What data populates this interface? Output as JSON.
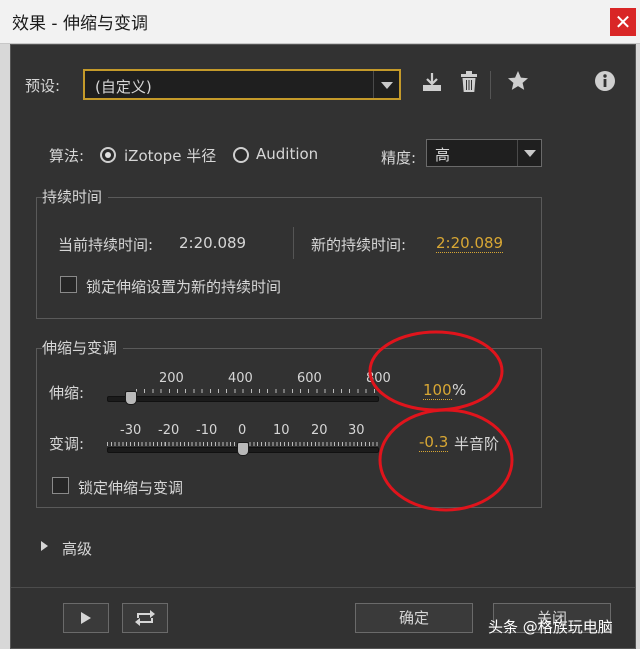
{
  "window": {
    "title": "效果 - 伸缩与变调",
    "close_glyph": "✕"
  },
  "preset": {
    "label": "预设:",
    "value": "(自定义)"
  },
  "toolbar": {
    "save_icon": "download-icon",
    "delete_icon": "trash-icon",
    "favorite_icon": "star-icon",
    "info_icon": "info-icon"
  },
  "algorithm": {
    "label": "算法:",
    "options": [
      {
        "label": "iZotope 半径",
        "selected": true
      },
      {
        "label": "Audition",
        "selected": false
      }
    ]
  },
  "precision": {
    "label": "精度:",
    "value": "高"
  },
  "duration": {
    "title": "持续时间",
    "current_label": "当前持续时间:",
    "current_value": "2:20.089",
    "new_label": "新的持续时间:",
    "new_value": "2:20.089",
    "lock_label": "锁定伸缩设置为新的持续时间"
  },
  "stretch_pitch": {
    "title": "伸缩与变调",
    "stretch": {
      "label": "伸缩:",
      "ticks": [
        "200",
        "400",
        "600",
        "800"
      ],
      "value": "100",
      "unit": "%",
      "position": 0.09
    },
    "pitch": {
      "label": "变调:",
      "ticks": [
        "-30",
        "-20",
        "-10",
        "0",
        "10",
        "20",
        "30"
      ],
      "value": "-0.3",
      "unit": "半音阶",
      "position": 0.5
    },
    "lock_label": "锁定伸缩与变调"
  },
  "advanced": {
    "label": "高级"
  },
  "footer": {
    "ok_label": "确定",
    "close_label": "关闭"
  },
  "watermark": {
    "text": "头条 @格族玩电脑"
  },
  "colors": {
    "accent": "#d8a734",
    "panel": "#323232",
    "annotation": "#e0141c"
  }
}
